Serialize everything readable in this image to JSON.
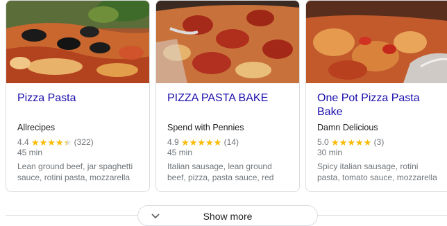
{
  "cards": [
    {
      "title": "Pizza Pasta",
      "source": "Allrecipes",
      "rating": "4.4",
      "rating_value": 4.4,
      "reviews": "(322)",
      "time": "45 min",
      "ingredients": "Lean ground beef, jar spaghetti sauce, rotini pasta, mozzarella"
    },
    {
      "title": "PIZZA PASTA BAKE",
      "source": "Spend with Pennies",
      "rating": "4.9",
      "rating_value": 4.9,
      "reviews": "(14)",
      "time": "45 min",
      "ingredients": "Italian sausage, lean ground beef, pizza, pasta sauce, red"
    },
    {
      "title": "One Pot Pizza Pasta Bake",
      "source": "Damn Delicious",
      "rating": "5.0",
      "rating_value": 5.0,
      "reviews": "(3)",
      "time": "30 min",
      "ingredients": "Spicy italian sausage, rotini pasta, tomato sauce, mozzarella"
    }
  ],
  "show_more": {
    "label": "Show more",
    "icon": "chevron-down-icon"
  },
  "colors": {
    "title_link": "#1a0dab",
    "star": "#fbbc04",
    "meta_text": "#70757a",
    "border": "#dadce0"
  }
}
